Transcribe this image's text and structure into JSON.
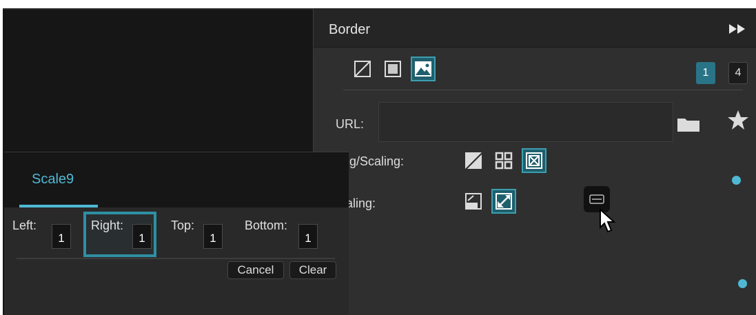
{
  "border_panel": {
    "title": "Border",
    "collapse_icon": "double-chevron-right-icon",
    "mode_icons": [
      "no-fill-icon",
      "solid-fill-icon",
      "image-fill-icon"
    ],
    "active_mode": "image-fill-icon",
    "count_options": [
      "1",
      "4"
    ],
    "active_count": "1",
    "url": {
      "label": "URL:",
      "value": "",
      "placeholder": ""
    },
    "folder_icon": "folder-icon",
    "star_icon": "star-icon",
    "tiling_label": "ing/Scaling:",
    "tiling_icons": [
      "stretch-icon",
      "tile-grid-icon",
      "scale-to-fit-icon"
    ],
    "scaling_label": "caling:",
    "scaling_icons": [
      "scale-corner-icon",
      "scale-diagonal-icon"
    ],
    "scale9_button_icon": "scale9-icon",
    "accent": "#4fb9d4"
  },
  "scale9": {
    "tab": "Scale9",
    "fields": [
      {
        "label": "Left:",
        "value": "1"
      },
      {
        "label": "Right:",
        "value": "1"
      },
      {
        "label": "Top:",
        "value": "1"
      },
      {
        "label": "Bottom:",
        "value": "1"
      }
    ],
    "cancel": "Cancel",
    "clear": "Clear"
  }
}
